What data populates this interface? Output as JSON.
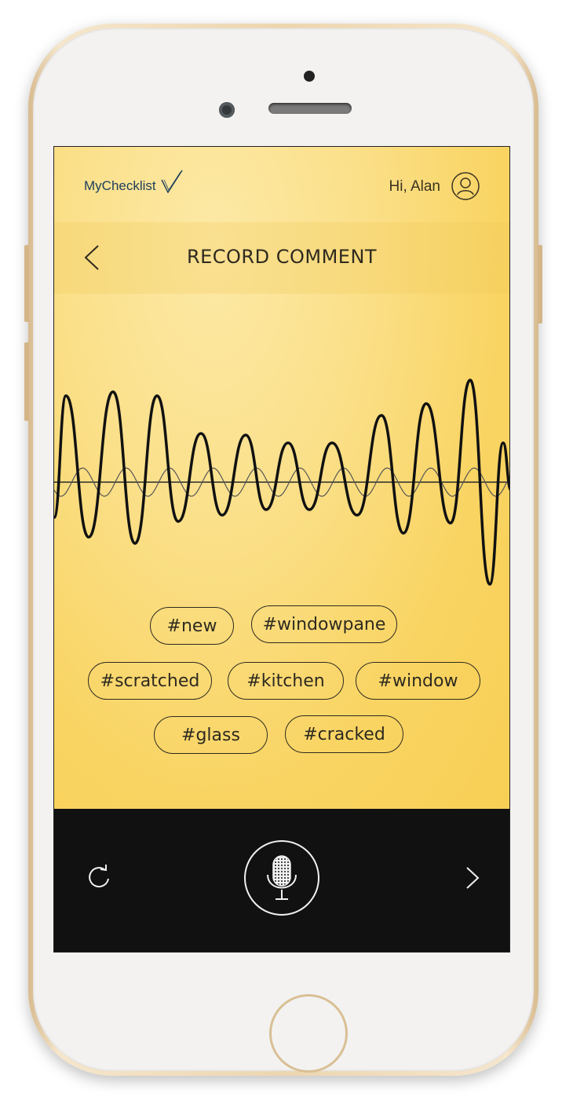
{
  "header": {
    "logo": "MyChecklist",
    "greeting": "Hi, Alan"
  },
  "titlebar": {
    "title": "RECORD COMMENT"
  },
  "tags": [
    "#new",
    "#windowpane",
    "#scratched",
    "#kitchen",
    "#window",
    "#glass",
    "#cracked"
  ],
  "icons": {
    "back": "chevron-left-icon",
    "user": "user-circle-icon",
    "refresh": "refresh-icon",
    "mic": "microphone-icon",
    "next": "chevron-right-icon"
  },
  "colors": {
    "screen_yellow": "#f9d462",
    "text_dark": "#2e2a1f",
    "logo_blue": "#1c3d5a",
    "control_bar": "#111111",
    "bezel_gold": "#ecd6b0"
  }
}
